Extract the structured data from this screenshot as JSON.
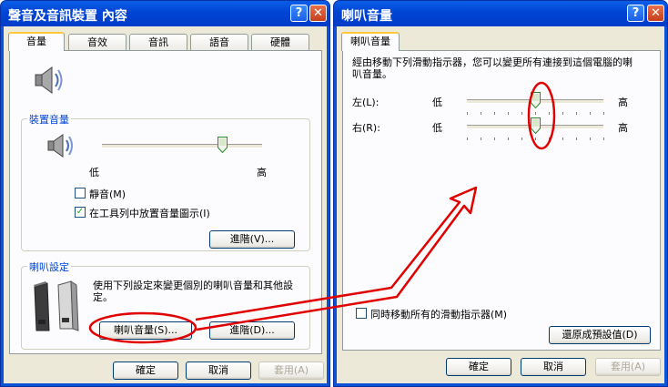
{
  "left_window": {
    "title": "聲音及音訊裝置 內容",
    "help_btn": "?",
    "close_btn": "✕",
    "tabs": [
      "音量",
      "音效",
      "音訊",
      "語音",
      "硬體"
    ],
    "device_volume": {
      "title": "裝置音量",
      "low": "低",
      "high": "高",
      "level": 0.75,
      "mute_label": "靜音(M)",
      "mute_checked": false,
      "tray_label": "在工具列中放置音量圖示(I)",
      "tray_checked": true,
      "advanced_button": "進階(V)..."
    },
    "speaker_settings": {
      "title": "喇叭設定",
      "description": "使用下列設定來變更個別的喇叭音量和其他設定。",
      "speaker_volume_button": "喇叭音量(S)...",
      "advanced_button": "進階(D)..."
    },
    "ok_button": "確定",
    "cancel_button": "取消",
    "apply_button": "套用(A)"
  },
  "right_window": {
    "title": "喇叭音量",
    "help_btn": "?",
    "close_btn": "✕",
    "tab": "喇叭音量",
    "instructions": "經由移動下列滑動指示器，您可以變更所有連接到這個電腦的喇叭音量。",
    "left_label": "左(L):",
    "right_label": "右(R):",
    "low": "低",
    "high": "高",
    "left_level": 0.5,
    "right_level": 0.5,
    "move_all_label": "同時移動所有的滑動指示器(M)",
    "move_all_checked": false,
    "restore_button": "還原成預設值(D)",
    "ok_button": "確定",
    "cancel_button": "取消",
    "apply_button": "套用(A)"
  },
  "colors": {
    "titlebar": "#0a5ee8",
    "client": "#ece9d8",
    "group_title": "#0046d5",
    "annotation": "#e00000"
  }
}
